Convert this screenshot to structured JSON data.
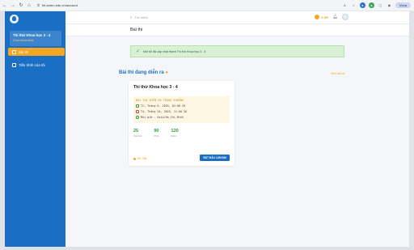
{
  "browser": {
    "url": "thi.ardeo.edu.vn/account",
    "profile_label": "Vona"
  },
  "sidebar": {
    "course": {
      "title": "Thi thử Khoa học 3 - 4",
      "link": "Chọn khóa khác"
    },
    "items": [
      {
        "label": "Bài thi",
        "icon": "exam-icon",
        "active": true
      },
      {
        "label": "Tiến trình của tôi",
        "icon": "progress-icon",
        "active": false
      }
    ]
  },
  "header": {
    "search_placeholder": "Tìm kiếm",
    "coins": "0 XP"
  },
  "page": {
    "title": "Bài thi"
  },
  "toast": {
    "message": "Mời tôi đã cập nhật thành Thi thử Khoa học 3 - 4"
  },
  "section": {
    "title": "Bài thi đang diễn ra",
    "see_all": "Xem tất cả"
  },
  "exam": {
    "title": "Thi thử Khoa học 3 - 4",
    "schedule_head": "BÀI THI DIỄN RA TRONG KHOẢNG",
    "start": "T2, Tháng 6, 2025, 02:00 CH",
    "end": "T4, Tháng 24, 2025, 11:00 SA",
    "timezone": "Múi giờ - Asia/Ho_Chi_Minh",
    "stats": [
      {
        "num": "25",
        "label": "Câu hỏi"
      },
      {
        "num": "90",
        "label": "Phút"
      },
      {
        "num": "120",
        "label": "Điểm"
      }
    ],
    "status": "Mở, Bắt",
    "start_button": "BẮT ĐẦU LÀM BÀI"
  },
  "colors": {
    "primary": "#1a6fc4",
    "accent": "#f5a623",
    "success": "#2e9b3f"
  }
}
